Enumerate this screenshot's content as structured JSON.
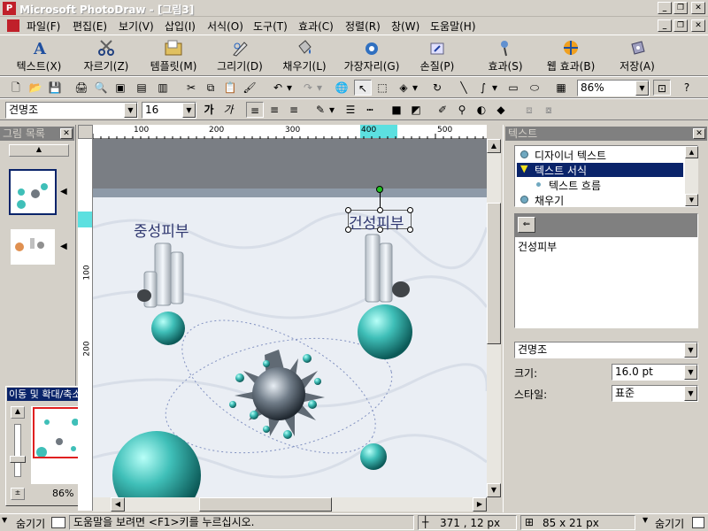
{
  "window": {
    "title": "Microsoft PhotoDraw - [그림3]",
    "app_icon": "photodraw-icon"
  },
  "menu": [
    "파일(F)",
    "편집(E)",
    "보기(V)",
    "삽입(I)",
    "서식(O)",
    "도구(T)",
    "효과(C)",
    "정렬(R)",
    "창(W)",
    "도움말(H)"
  ],
  "bigbar": [
    "텍스트(X)",
    "자르기(Z)",
    "템플릿(M)",
    "그리기(D)",
    "채우기(L)",
    "가장자리(G)",
    "손질(P)",
    "효과(S)",
    "웹 효과(B)",
    "저장(A)"
  ],
  "toolbar": {
    "zoom_value": "86%"
  },
  "fontbar": {
    "font": "견명조",
    "size": "16"
  },
  "leftpanel": {
    "title": "그림 목록"
  },
  "navigator": {
    "title": "이동 및 확대/축소",
    "zoom": "86%"
  },
  "ruler": {
    "top_labels": [
      "100",
      "200",
      "300",
      "400",
      "500"
    ],
    "left_labels": [
      "100",
      "200"
    ]
  },
  "canvas": {
    "text1": "중성피부",
    "text2": "건성피부"
  },
  "rightpanel": {
    "title": "텍스트",
    "tree": [
      {
        "label": "디자이너 텍스트",
        "level": 0,
        "selected": false
      },
      {
        "label": "텍스트 서식",
        "level": 0,
        "selected": true
      },
      {
        "label": "텍스트 흐름",
        "level": 1,
        "selected": false
      },
      {
        "label": "채우기",
        "level": 0,
        "selected": false
      }
    ],
    "text_content": "건성피부",
    "font": "견명조",
    "size_label": "크기:",
    "size_value": "16.0 pt",
    "style_label": "스타일:",
    "style_value": "표준"
  },
  "status": {
    "hide_left": "숨기기",
    "help": "도움말을 보려면 <F1>키를 누르십시오.",
    "coords": "371 , 12  px",
    "size": "85 x 21  px",
    "hide_right": "숨기기"
  },
  "colors": {
    "canvas_bg": "#e8ecf2",
    "sphere": "#3fbfb8",
    "selection": "#0a246a",
    "titlebar": "#d4d0c8"
  }
}
